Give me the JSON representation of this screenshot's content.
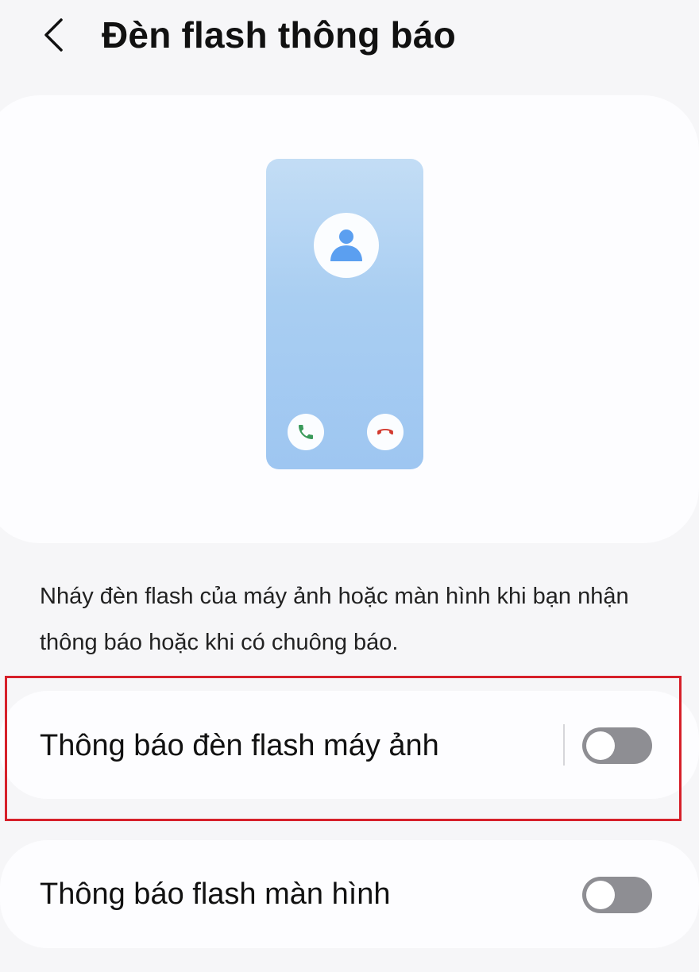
{
  "header": {
    "title": "Đèn flash thông báo",
    "back_icon": "chevron-left-icon"
  },
  "illustration": {
    "phone_gradient_top": "#c3ddf5",
    "phone_gradient_bottom": "#9ec6f1",
    "avatar_icon": "person-icon",
    "avatar_color": "#5b9ff0",
    "accept_icon": "phone-accept-icon",
    "accept_color": "#3a9a5a",
    "decline_icon": "phone-decline-icon",
    "decline_color": "#d23a2f"
  },
  "description": "Nháy đèn flash của máy ảnh hoặc màn hình khi bạn nhận thông báo hoặc khi có chuông báo.",
  "settings": [
    {
      "label": "Thông báo đèn flash máy ảnh",
      "enabled": false
    },
    {
      "label": "Thông báo flash màn hình",
      "enabled": false
    }
  ],
  "highlight": {
    "color": "#d6202a",
    "target": "Thông báo đèn flash máy ảnh"
  },
  "colors": {
    "background": "#f6f6f8",
    "card": "#fdfdff",
    "toggle_off": "#8e8e93"
  }
}
